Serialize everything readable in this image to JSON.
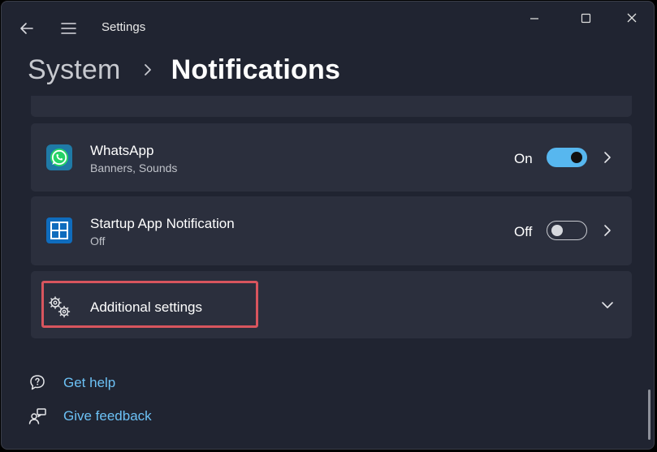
{
  "window": {
    "app_title": "Settings"
  },
  "breadcrumb": {
    "parent": "System",
    "current": "Notifications"
  },
  "apps": [
    {
      "name": "WhatsApp",
      "subtitle": "Banners, Sounds",
      "state_label": "On",
      "enabled": true,
      "icon": "whatsapp-icon"
    },
    {
      "name": "Startup App Notification",
      "subtitle": "Off",
      "state_label": "Off",
      "enabled": false,
      "icon": "startup-app-icon"
    }
  ],
  "additional": {
    "label": "Additional settings",
    "icon": "gears-icon"
  },
  "links": {
    "help": "Get help",
    "feedback": "Give feedback"
  },
  "colors": {
    "background": "#202431",
    "card": "#2b2f3d",
    "accent": "#57b7ef",
    "link": "#6cc1f5",
    "highlight": "#d8555e",
    "whatsapp_green": "#25d366"
  }
}
